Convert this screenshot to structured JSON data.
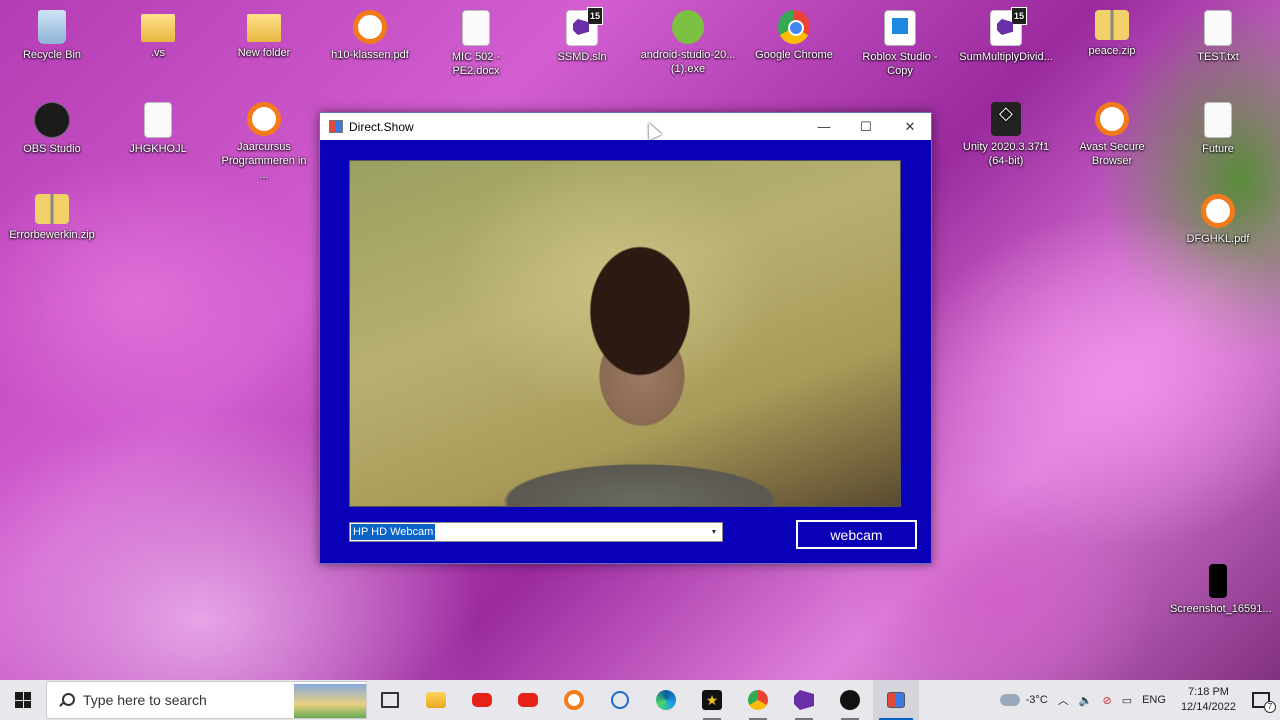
{
  "desktop": {
    "icons": [
      {
        "label": "Recycle Bin",
        "icon": "recycle-bin-icon"
      },
      {
        "label": ".vs",
        "icon": "folder-icon"
      },
      {
        "label": "New folder",
        "icon": "folder-icon"
      },
      {
        "label": "h10-klassen.pdf",
        "icon": "avast-pdf-icon"
      },
      {
        "label": "MIC 502 - PE2.docx",
        "icon": "docx-icon"
      },
      {
        "label": "SSMD.sln",
        "icon": "visual-studio-icon",
        "badge": "15"
      },
      {
        "label": "android-studio-20... (1).exe",
        "icon": "android-studio-icon"
      },
      {
        "label": "Google Chrome",
        "icon": "chrome-icon"
      },
      {
        "label": "Roblox Studio - Copy",
        "icon": "roblox-studio-icon"
      },
      {
        "label": "SumMultiplyDivid...",
        "icon": "visual-studio-icon",
        "badge": "15"
      },
      {
        "label": "peace.zip",
        "icon": "zip-icon"
      },
      {
        "label": "TEST.txt",
        "icon": "text-file-icon"
      },
      {
        "label": "OBS Studio",
        "icon": "obs-icon"
      },
      {
        "label": "JHGKHOJL",
        "icon": "file-icon"
      },
      {
        "label": "Jaarcursus Programmeren in ...",
        "icon": "avast-pdf-icon"
      },
      {
        "label": "Unity 2020.3.37f1 (64-bit)",
        "icon": "unity-icon"
      },
      {
        "label": "Avast Secure Browser",
        "icon": "avast-browser-icon"
      },
      {
        "label": "Future",
        "icon": "file-icon"
      },
      {
        "label": "Errorbewerkin.zip",
        "icon": "zip-icon"
      },
      {
        "label": "DFGHKL.pdf",
        "icon": "avast-pdf-icon"
      },
      {
        "label": "Screenshot_16591...",
        "icon": "image-file-icon"
      }
    ]
  },
  "window": {
    "title": "Direct.Show",
    "minimize_symbol": "—",
    "maximize_symbol": "☐",
    "close_symbol": "✕",
    "background_color": "#0a00b8",
    "device_select": {
      "value": "HP HD Webcam",
      "arrow": "▼"
    },
    "webcam_button_label": "webcam"
  },
  "taskbar": {
    "search_placeholder": "Type here to search",
    "pinned": [
      {
        "name": "task-view",
        "icon": "task-view-icon"
      },
      {
        "name": "file-explorer",
        "icon": "folder-icon"
      },
      {
        "name": "youtube",
        "icon": "youtube-icon"
      },
      {
        "name": "youtube-2",
        "icon": "youtube-icon"
      },
      {
        "name": "avast-browser",
        "icon": "avast-browser-icon"
      },
      {
        "name": "camera",
        "icon": "camera-icon"
      },
      {
        "name": "edge",
        "icon": "edge-icon"
      },
      {
        "name": "movie-maker",
        "icon": "star-icon"
      },
      {
        "name": "chrome",
        "icon": "chrome-icon"
      },
      {
        "name": "visual-studio",
        "icon": "visual-studio-icon"
      },
      {
        "name": "obs",
        "icon": "obs-icon"
      },
      {
        "name": "direct-show",
        "icon": "app-window-icon"
      }
    ],
    "tray": {
      "temperature": "-3°C",
      "language": "ENG",
      "time": "7:18 PM",
      "date": "12/14/2022",
      "notification_count": "7"
    }
  }
}
